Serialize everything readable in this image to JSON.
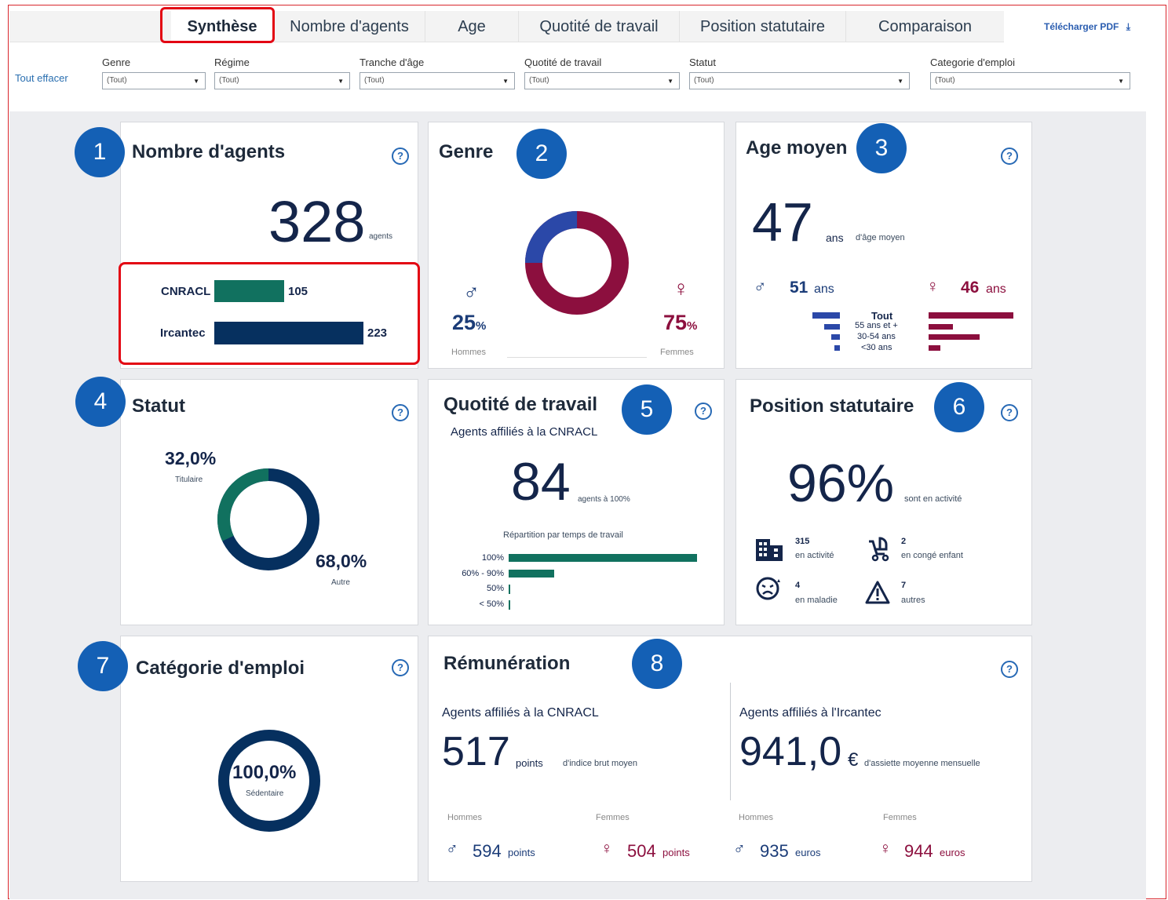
{
  "tabs": [
    "Synthèse",
    "Nombre d'agents",
    "Age",
    "Quotité de travail",
    "Position statutaire",
    "Comparaison"
  ],
  "pdf_button": "Télécharger PDF",
  "pdf_icon": "download-icon",
  "clear_filters": "Tout effacer",
  "filters": [
    {
      "label": "Genre",
      "value": "(Tout)"
    },
    {
      "label": "Régime",
      "value": "(Tout)"
    },
    {
      "label": "Tranche d'âge",
      "value": "(Tout)"
    },
    {
      "label": "Quotité de travail",
      "value": "(Tout)"
    },
    {
      "label": "Statut",
      "value": "(Tout)"
    },
    {
      "label": "Categorie d'emploi",
      "value": "(Tout)"
    }
  ],
  "badges": [
    "1",
    "2",
    "3",
    "4",
    "5",
    "6",
    "7",
    "8"
  ],
  "colors": {
    "teal": "#11715f",
    "navy": "#06305f",
    "wine": "#8c0f3e",
    "blue": "#2b48a8",
    "badge": "#1460b5",
    "highlight": "#e30613"
  },
  "agents": {
    "title": "Nombre  d'agents",
    "total": "328",
    "unit": "agents",
    "bars": [
      {
        "label": "CNRACL",
        "value": 105,
        "display": "105"
      },
      {
        "label": "Ircantec",
        "value": 223,
        "display": "223"
      }
    ]
  },
  "genre": {
    "title": "Genre",
    "male_symbol": "♂",
    "female_symbol": "♀",
    "male_pct": "25",
    "female_pct": "75",
    "pct_sign": "%",
    "male_label": "Hommes",
    "female_label": "Femmes",
    "male_share": 0.25,
    "female_share": 0.75
  },
  "age": {
    "title": "Age moyen",
    "value": "47",
    "unit": "ans",
    "sub": "d'âge moyen",
    "male_symbol": "♂",
    "male_value": "51",
    "male_unit": "ans",
    "female_symbol": "♀",
    "female_value": "46",
    "female_unit": "ans",
    "brackets": [
      "Tout",
      "55 ans et +",
      "30-54 ans",
      "<30 ans"
    ],
    "male_bars": [
      0.8,
      0.45,
      0.25,
      0.15
    ],
    "female_bars": [
      1.0,
      0.29,
      0.6,
      0.14
    ]
  },
  "statut": {
    "title": "Statut",
    "titulaire_pct": "32,0%",
    "titulaire_label": "Titulaire",
    "autre_pct": "68,0%",
    "autre_label": "Autre",
    "titulaire_share": 0.32
  },
  "quotite": {
    "title": "Quotité de travail",
    "subtitle": "Agents affiliés à la CNRACL",
    "value": "84",
    "unit": "agents à 100%",
    "chart_title": "Répartition par temps de travail",
    "rows": [
      {
        "label": "100%",
        "value": 1.0
      },
      {
        "label": "60% - 90%",
        "value": 0.24
      },
      {
        "label": "50%",
        "value": 0.01
      },
      {
        "label": "< 50%",
        "value": 0.01
      }
    ]
  },
  "position": {
    "title": "Position statutaire",
    "value": "96%",
    "unit": "sont en  activité",
    "items": [
      {
        "icon": "building-icon",
        "count": "315",
        "label": "en activité"
      },
      {
        "icon": "stroller-icon",
        "count": "2",
        "label": "en congé enfant"
      },
      {
        "icon": "sick-face-icon",
        "count": "4",
        "label": "en maladie"
      },
      {
        "icon": "warning-icon",
        "count": "7",
        "label": "autres"
      }
    ]
  },
  "categorie": {
    "title": "Catégorie d'emploi",
    "value": "100,0%",
    "label": "Sédentaire"
  },
  "remuneration": {
    "title": "Rémunération",
    "cnracl_label": "Agents affiliés à la CNRACL",
    "cnracl_value": "517",
    "cnracl_unit": "points",
    "cnracl_sub": "d'indice brut moyen",
    "ircantec_label": "Agents affiliés  à l'Ircantec",
    "ircantec_value": "941,0",
    "ircantec_unit": "€",
    "ircantec_sub": "d'assiette moyenne mensuelle",
    "breakdown": [
      {
        "label": "Hommes",
        "symbol": "♂",
        "value": "594",
        "unit": "points"
      },
      {
        "label": "Femmes",
        "symbol": "♀",
        "value": "504",
        "unit": "points"
      },
      {
        "label": "Hommes",
        "symbol": "♂",
        "value": "935",
        "unit": "euros"
      },
      {
        "label": "Femmes",
        "symbol": "♀",
        "value": "944",
        "unit": "euros"
      }
    ]
  }
}
